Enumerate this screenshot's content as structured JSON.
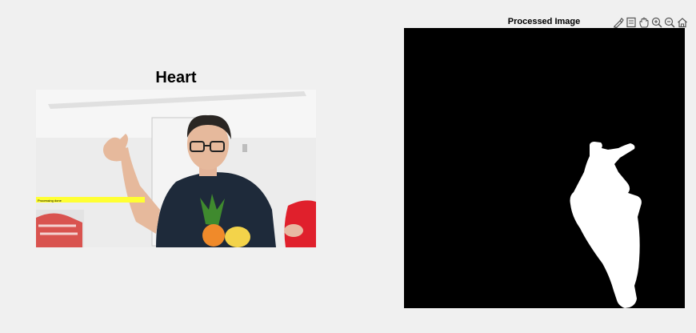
{
  "left_axes": {
    "title": "Heart",
    "overlay_text": "Processing done"
  },
  "right_axes": {
    "title": "Processed Image"
  },
  "toolbar": {
    "buttons": [
      {
        "icon": "brush-icon"
      },
      {
        "icon": "data-tip-icon"
      },
      {
        "icon": "pan-hand-icon"
      },
      {
        "icon": "zoom-in-icon"
      },
      {
        "icon": "zoom-out-icon"
      },
      {
        "icon": "home-icon"
      }
    ]
  },
  "colors": {
    "figure_background": "#f0f0f0",
    "mask_background": "#000000",
    "mask_foreground": "#ffffff",
    "progress_bar": "#ffff33"
  }
}
